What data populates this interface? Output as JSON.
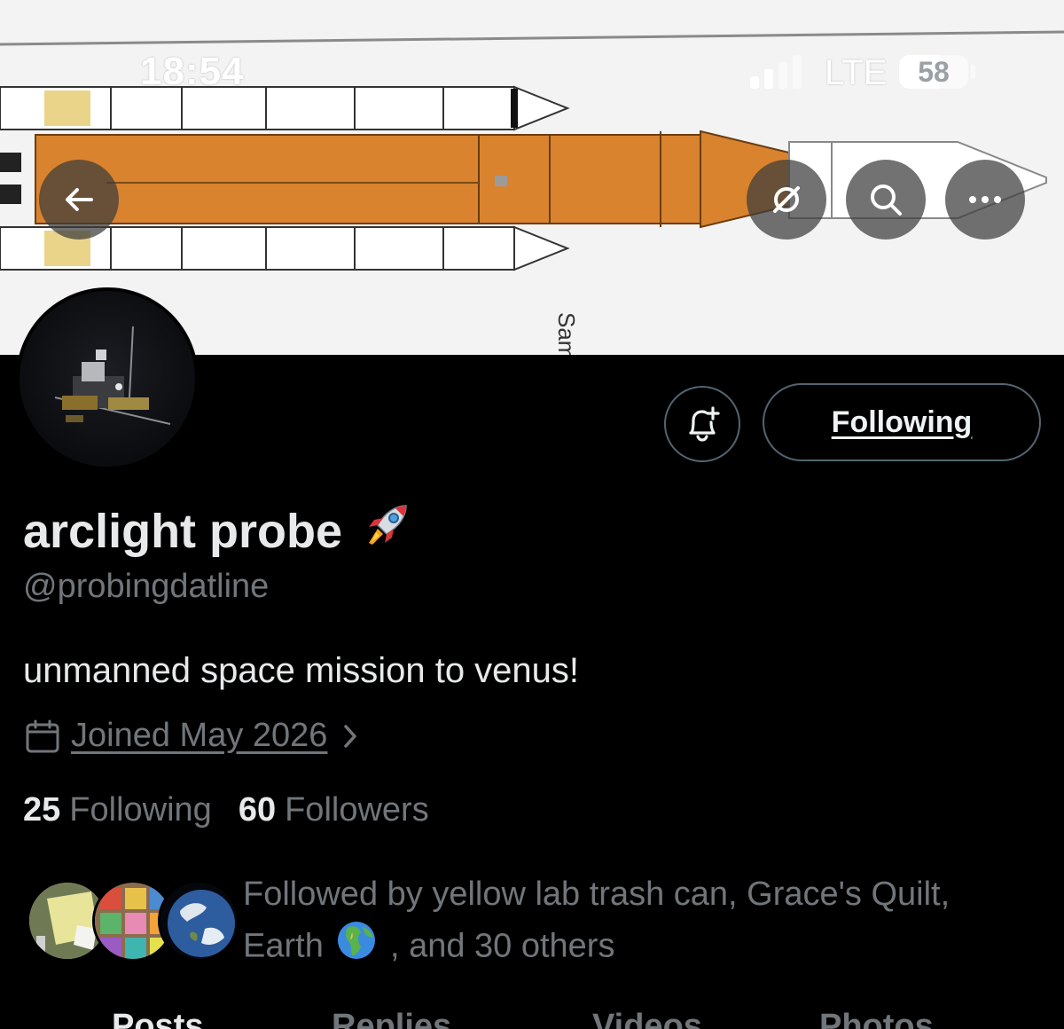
{
  "status_bar": {
    "time": "18:54",
    "network": "LTE",
    "battery": "58",
    "battery_level": 0.58
  },
  "header_actions": {
    "back_icon": "arrow-left-icon",
    "grok_icon": "slashed-circle-icon",
    "search_icon": "search-icon",
    "more_icon": "more-horizontal-icon"
  },
  "profile": {
    "display_name": "arclight probe",
    "name_emoji": "rocket",
    "handle": "@probingdatline",
    "bio": "unmanned space mission to venus!",
    "joined": "Joined May 2026",
    "follow_button": "Following",
    "following_count": "25",
    "following_label": "Following",
    "followers_count": "60",
    "followers_label": "Followers"
  },
  "followed_by": {
    "line_1": "Followed by yellow lab trash can, Grace's Quilt,",
    "line_2_start": "Earth",
    "line_2_end": ", and 30 others",
    "emoji": "globe-africa-europe"
  },
  "tabs": [
    {
      "label": "Posts",
      "active": true
    },
    {
      "label": "Replies",
      "active": false
    },
    {
      "label": "Videos",
      "active": false
    },
    {
      "label": "Photos",
      "active": false
    }
  ],
  "banner": {
    "caption": "Sam"
  },
  "colors": {
    "background": "#000000",
    "primary_text": "#e7e9ea",
    "secondary_text": "#71767b",
    "border": "#536471",
    "rocket_orange": "#d9832e"
  }
}
